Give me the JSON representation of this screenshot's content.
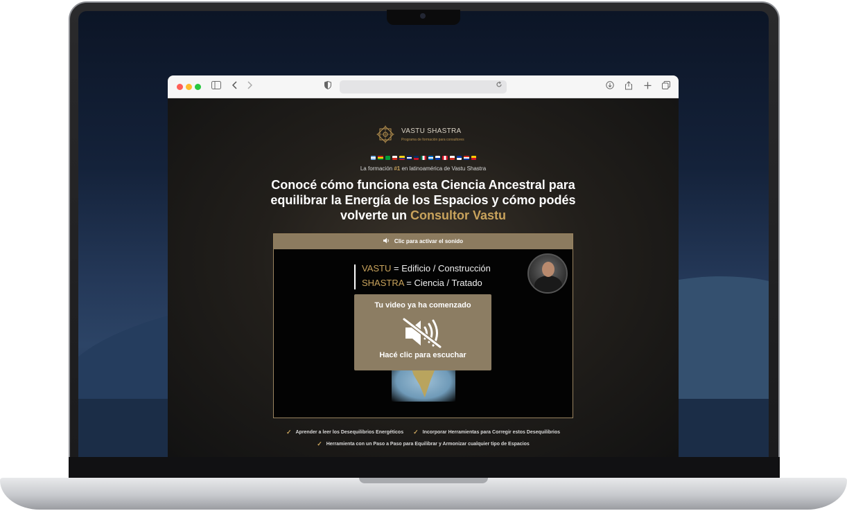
{
  "browser": {
    "toolbar_icons": {
      "sidebar": "sidebar-icon",
      "back": "chevron-left-icon",
      "forward": "chevron-right-icon",
      "shield": "shield-icon",
      "reload": "reload-icon",
      "download": "download-icon",
      "share": "share-icon",
      "new_tab": "plus-icon",
      "tabs": "tabs-icon"
    },
    "traffic_lights": [
      "#ff5f57",
      "#febc2e",
      "#28c840"
    ]
  },
  "page": {
    "brand": {
      "name": "VASTU SHASTRA",
      "subtitle": "Programa de formación para consultores"
    },
    "tagline_prefix": "La formación ",
    "tagline_highlight": "#1",
    "tagline_suffix": " en latinoamérica de Vastu Shastra",
    "headline_line1": "Conocé cómo funciona esta Ciencia Ancestral para",
    "headline_line2": "equilibrar la Energía de los Espacios y cómo podés",
    "headline_line3_prefix": "volverte un ",
    "headline_accent": "Consultor Vastu",
    "colors": {
      "accent": "#c9a35c",
      "video_bar": "#8c7b5f",
      "overlay": "#8c7d63"
    }
  },
  "video": {
    "bar_label": "Clic para activar el sonido",
    "line1_term": "VASTU",
    "line1_rest": " = Edificio / Construcción",
    "line2_term": "SHASTRA",
    "line2_rest": " = Ciencia / Tratado",
    "overlay_title": "Tu video ya ha comenzado",
    "overlay_cta": "Hacé clic para escuchar"
  },
  "benefits": [
    "Aprender a leer los Desequilibrios Energéticos",
    "Incorporar Herramientas para Corregir estos Desequilibrios",
    "Herramienta con un Paso a Paso para Equilibrar y Armonizar cualquier tipo de Espacios"
  ]
}
